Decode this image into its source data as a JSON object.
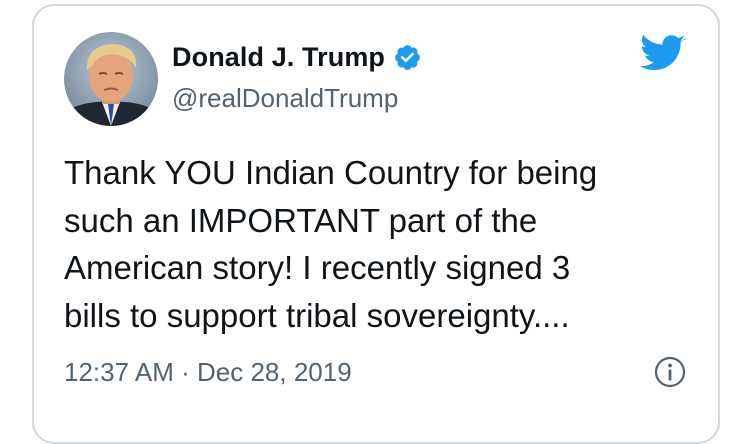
{
  "tweet": {
    "author_name": "Donald J. Trump",
    "author_handle": "@realDonaldTrump",
    "text": "Thank YOU Indian Country for being\nsuch an IMPORTANT part of the\nAmerican story! I recently signed 3\nbills to support tribal sovereignty....",
    "time": "12:37 AM",
    "separator": "·",
    "date": "Dec 28, 2019"
  },
  "icons": {
    "verified": "verified-badge-icon",
    "brand": "twitter-bird-icon",
    "info": "info-icon"
  },
  "colors": {
    "twitter_blue": "#1d9bf0",
    "text_primary": "#0f1419",
    "text_secondary": "#536471",
    "border": "#cfd9de"
  }
}
